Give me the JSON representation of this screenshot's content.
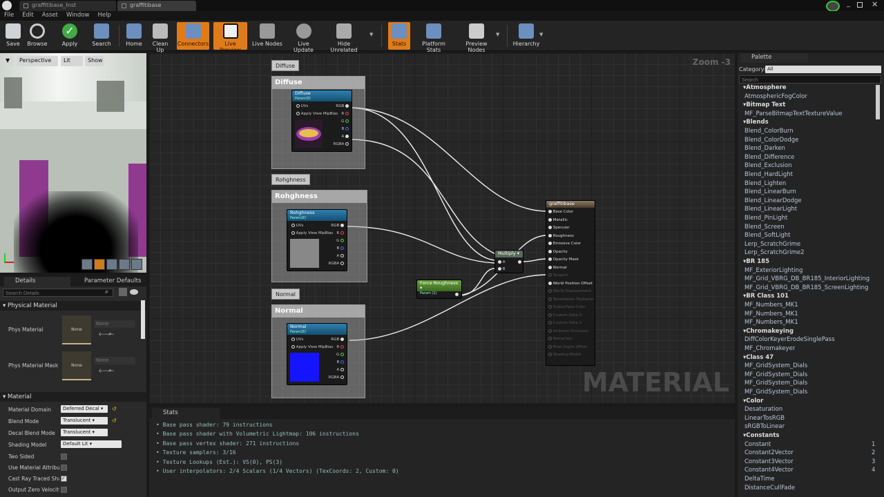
{
  "tabs": [
    {
      "label": "graffitibase_Inst"
    },
    {
      "label": "graffitibase"
    }
  ],
  "menu": [
    "File",
    "Edit",
    "Asset",
    "Window",
    "Help"
  ],
  "toolbar": [
    {
      "label": "Save",
      "icon": "save-icon"
    },
    {
      "label": "Browse",
      "icon": "browse-icon"
    },
    {
      "label": "Apply",
      "icon": "apply-icon"
    },
    {
      "label": "Search",
      "icon": "search-icon"
    },
    {
      "label": "Home",
      "icon": "home-icon"
    },
    {
      "label": "Clean Up",
      "icon": "clean-up-icon"
    },
    {
      "label": "Connectors",
      "icon": "connectors-icon"
    },
    {
      "label": "Live Preview",
      "icon": "live-preview-icon"
    },
    {
      "label": "Live Nodes",
      "icon": "live-nodes-icon"
    },
    {
      "label": "Live Update",
      "icon": "live-update-icon"
    },
    {
      "label": "Hide Unrelated",
      "icon": "hide-unrelated-icon"
    },
    {
      "label": "Stats",
      "icon": "stats-icon"
    },
    {
      "label": "Platform Stats",
      "icon": "platform-stats-icon"
    },
    {
      "label": "Preview Nodes",
      "icon": "preview-nodes-icon"
    },
    {
      "label": "Hierarchy",
      "icon": "hierarchy-icon"
    }
  ],
  "viewport": {
    "perspective": "Perspective",
    "lit": "Lit",
    "show": "Show"
  },
  "details": {
    "tab1": "Details",
    "tab2": "Parameter Defaults",
    "search_placeholder": "Search Details",
    "phys_section": "Physical Material",
    "phys_material": "Phys Material",
    "phys_mask": "Phys Material Mask",
    "none": "None",
    "material_section": "Material",
    "rows": [
      {
        "label": "Material Domain",
        "value": "Deferred Decal"
      },
      {
        "label": "Blend Mode",
        "value": "Translucent"
      },
      {
        "label": "Decal Blend Mode",
        "value": "Translucent"
      },
      {
        "label": "Shading Model",
        "value": "Default Lit"
      }
    ],
    "checks": [
      {
        "label": "Two Sided",
        "checked": false
      },
      {
        "label": "Use Material Attributes",
        "checked": false
      },
      {
        "label": "Cast Ray Traced Shadows",
        "checked": true
      },
      {
        "label": "Output Zero Velocity",
        "checked": false
      }
    ]
  },
  "graph": {
    "zoom": "Zoom -3",
    "watermark": "MATERIAL",
    "comments": [
      {
        "tag": "Diffuse",
        "title": "Diffuse"
      },
      {
        "tag": "Rohghness",
        "title": "Rohghness"
      },
      {
        "tag": "Normal",
        "title": "Normal"
      }
    ],
    "diffuse_node": {
      "title": "Diffuse",
      "sub": "Param2D"
    },
    "rough_node": {
      "title": "Rohghness",
      "sub": "Param2D"
    },
    "normal_node": {
      "title": "Normal",
      "sub": "Param2D"
    },
    "input_pins": [
      "UVs",
      "Apply View MipBias"
    ],
    "output_pins": [
      "RGB",
      "R",
      "G",
      "B",
      "A",
      "RGBA"
    ],
    "multiply": {
      "title": "Multiply",
      "a": "A",
      "b": "B"
    },
    "force": {
      "title": "Force Roughness",
      "sub": "Param (1)"
    },
    "result": {
      "title": "graffitibase",
      "pins": [
        "Base Color",
        "Metallic",
        "Specular",
        "Roughness",
        "Emissive Color",
        "Opacity",
        "Opacity Mask",
        "Normal",
        "Tangent",
        "World Position Offset",
        "World Displacement",
        "Tessellation Multiplier",
        "Subsurface Color",
        "Custom Data 0",
        "Custom Data 1",
        "Ambient Occlusion",
        "Refraction",
        "Pixel Depth Offset",
        "Shading Model"
      ]
    }
  },
  "stats": {
    "tab": "Stats",
    "lines": [
      "Base pass shader: 79 instructions",
      "Base pass shader with Volumetric Lightmap: 106 instructions",
      "Base pass vertex shader: 271 instructions",
      "Texture samplers: 3/16",
      "Texture Lookups (Est.): VS(0), PS(3)",
      "User interpolators: 2/4 Scalars (1/4 Vectors) (TexCoords: 2, Custom: 0)"
    ]
  },
  "palette": {
    "tab": "Palette",
    "category_label": "Category:",
    "category_value": "All",
    "search_placeholder": "Search",
    "entries": [
      {
        "cat": "Atmosphere"
      },
      {
        "item": "AtmosphericFogColor"
      },
      {
        "cat": "Bitmap Text"
      },
      {
        "item": "MF_ParseBitmapTextTextureValue"
      },
      {
        "cat": "Blends"
      },
      {
        "item": "Blend_ColorBurn"
      },
      {
        "item": "Blend_ColorDodge"
      },
      {
        "item": "Blend_Darken"
      },
      {
        "item": "Blend_Difference"
      },
      {
        "item": "Blend_Exclusion"
      },
      {
        "item": "Blend_HardLight"
      },
      {
        "item": "Blend_Lighten"
      },
      {
        "item": "Blend_LinearBurn"
      },
      {
        "item": "Blend_LinearDodge"
      },
      {
        "item": "Blend_LinearLight"
      },
      {
        "item": "Blend_PinLight"
      },
      {
        "item": "Blend_Screen"
      },
      {
        "item": "Blend_SoftLight"
      },
      {
        "item": "Lerp_ScratchGrime"
      },
      {
        "item": "Lerp_ScratchGrime2"
      },
      {
        "cat": "BR 185"
      },
      {
        "item": "MF_ExteriorLighting"
      },
      {
        "item": "MF_Grid_VBRG_DB_BR185_InteriorLighting"
      },
      {
        "item": "MF_Grid_VBRG_DB_BR185_ScreenLighting"
      },
      {
        "cat": "BR Class 101"
      },
      {
        "item": "MF_Numbers_MK1"
      },
      {
        "item": "MF_Numbers_MK1"
      },
      {
        "item": "MF_Numbers_MK1"
      },
      {
        "cat": "Chromakeying"
      },
      {
        "item": "DiffColorKeyerErodeSinglePass"
      },
      {
        "item": "MF_Chromakeyer"
      },
      {
        "cat": "Class 47"
      },
      {
        "item": "MF_GridSystem_Dials"
      },
      {
        "item": "MF_GridSystem_Dials"
      },
      {
        "item": "MF_GridSystem_Dials"
      },
      {
        "item": "MF_GridSystem_Dials"
      },
      {
        "cat": "Color"
      },
      {
        "item": "Desaturation"
      },
      {
        "item": "LinearTosRGB"
      },
      {
        "item": "sRGBToLinear"
      },
      {
        "cat": "Constants"
      },
      {
        "item": "Constant",
        "key": "1"
      },
      {
        "item": "Constant2Vector",
        "key": "2"
      },
      {
        "item": "Constant3Vector",
        "key": "3"
      },
      {
        "item": "Constant4Vector",
        "key": "4"
      },
      {
        "item": "DeltaTime"
      },
      {
        "item": "DistanceCullFade"
      }
    ]
  }
}
